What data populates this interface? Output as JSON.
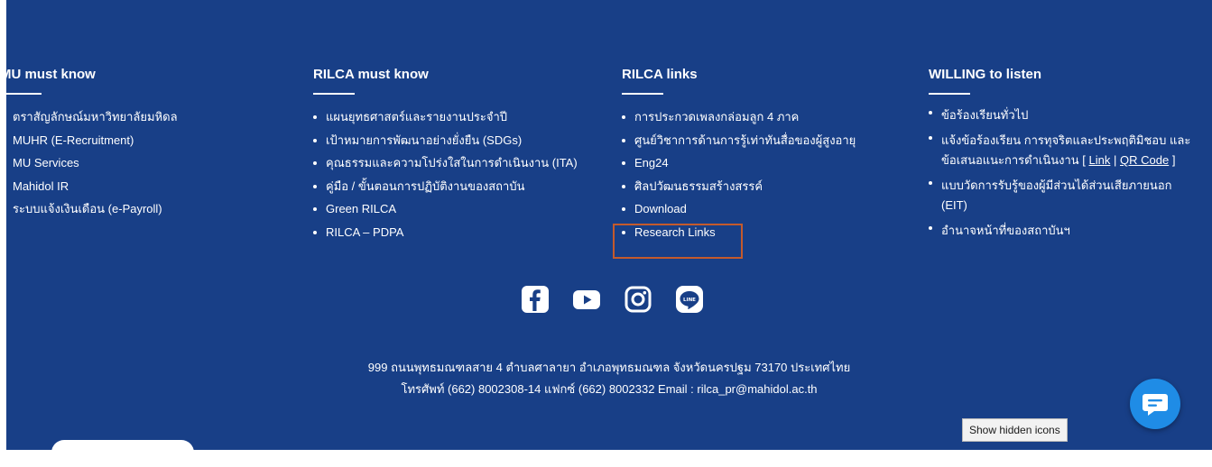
{
  "columns": {
    "mu": {
      "title": "MU must know",
      "items": [
        "ตราสัญลักษณ์มหาวิทยาลัยมหิดล",
        "MUHR (E-Recruitment)",
        "MU Services",
        "Mahidol IR",
        "ระบบแจ้งเงินเดือน (e-Payroll)"
      ]
    },
    "rilca": {
      "title": "RILCA must know",
      "items": [
        "แผนยุทธศาสตร์และรายงานประจำปี",
        "เป้าหมายการพัฒนาอย่างยั่งยืน (SDGs)",
        "คุณธรรมและความโปร่งใสในการดำเนินงาน (ITA)",
        "คู่มือ / ขั้นตอนการปฏิบัติงานของสถาบัน",
        "Green RILCA",
        "RILCA – PDPA"
      ]
    },
    "links": {
      "title": "RILCA links",
      "items": [
        "การประกวดเพลงกล่อมลูก 4 ภาค",
        "ศูนย์วิชาการด้านการรู้เท่าทันสื่อของผู้สูงอายุ",
        "Eng24",
        "ศิลปวัฒนธรรมสร้างสรรค์",
        "Download",
        "Research Links"
      ]
    },
    "willing": {
      "title": "WILLING to listen",
      "items": {
        "general": "ข้อร้องเรียนทั่วไป",
        "complaint_prefix": "แจ้งข้อร้องเรียน การทุจริตและประพฤติมิชอบ และข้อเสนอแนะการดำเนินงาน [",
        "link_label": "Link",
        "separator": "|",
        "qr_label": "QR Code",
        "complaint_suffix": "]",
        "survey": "แบบวัดการรับรู้ของผู้มีส่วนได้ส่วนเสียภายนอก (EIT)",
        "duty": "อำนาจหน้าที่ของสถาบันฯ"
      }
    }
  },
  "social": [
    "facebook-icon",
    "youtube-icon",
    "instagram-icon",
    "line-icon"
  ],
  "address": {
    "line1": "999 ถนนพุทธมณฑลสาย 4 ตำบลศาลายา อำเภอพุทธมณฑล จังหวัดนครปฐม 73170 ประเทศไทย",
    "line2": "โทรศัพท์ (662) 8002308-14 แฟกซ์ (662) 8002332 Email : rilca_pr@mahidol.ac.th"
  },
  "tooltip": "Show hidden icons",
  "colors": {
    "background": "#183f87",
    "highlight": "#c45a2c",
    "chat": "#1f8ce6"
  }
}
